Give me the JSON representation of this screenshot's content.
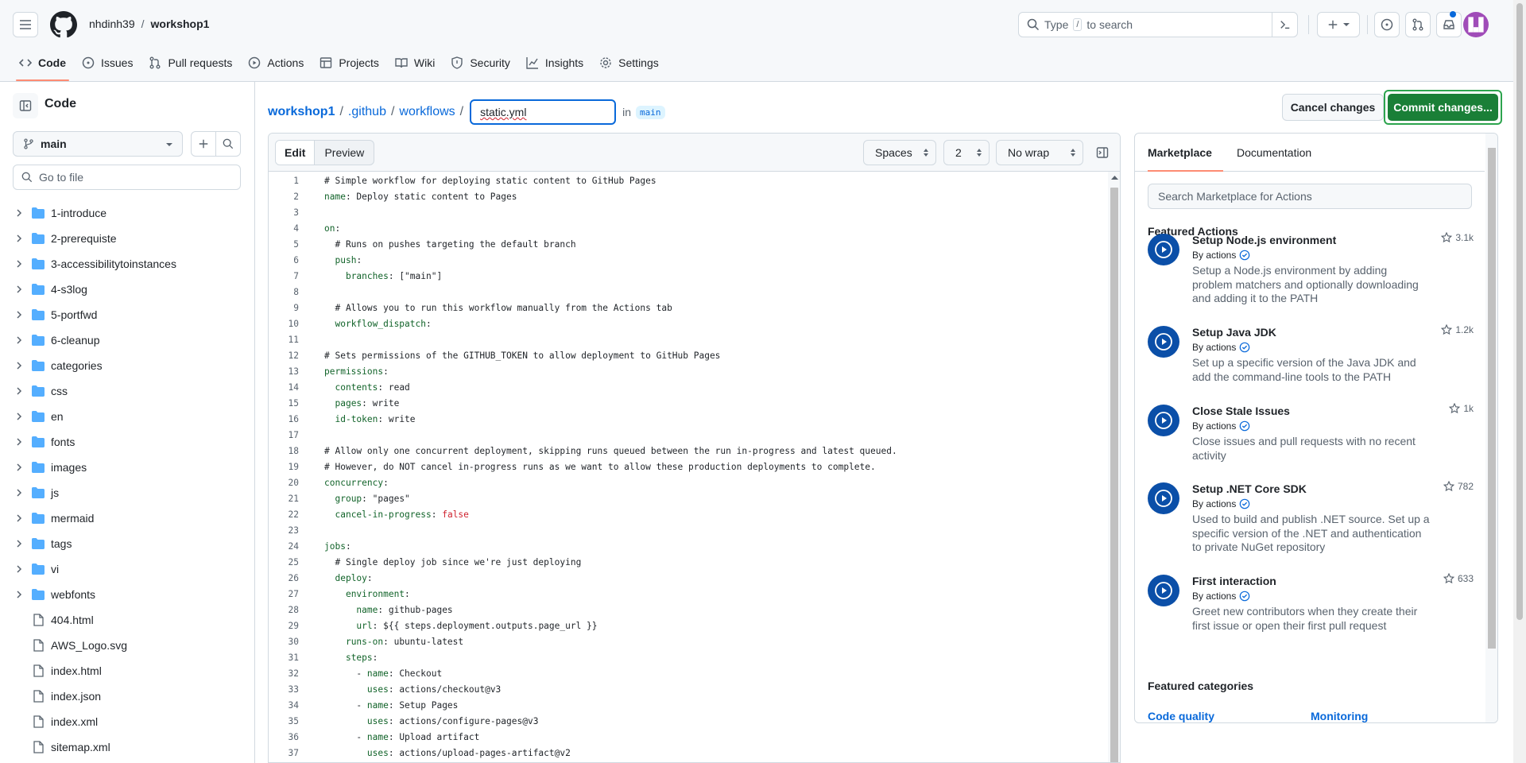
{
  "header": {
    "owner": "nhdinh39",
    "separator": "/",
    "repo": "workshop1",
    "search_placeholder_pre": "Type",
    "search_key": "/",
    "search_placeholder_post": "to search"
  },
  "tabs": [
    {
      "label": "Code",
      "icon": "code-icon",
      "selected": true
    },
    {
      "label": "Issues",
      "icon": "issue-opened-icon"
    },
    {
      "label": "Pull requests",
      "icon": "git-pull-request-icon"
    },
    {
      "label": "Actions",
      "icon": "play-icon"
    },
    {
      "label": "Projects",
      "icon": "table-icon"
    },
    {
      "label": "Wiki",
      "icon": "book-icon"
    },
    {
      "label": "Security",
      "icon": "shield-icon"
    },
    {
      "label": "Insights",
      "icon": "graph-icon"
    },
    {
      "label": "Settings",
      "icon": "gear-icon"
    }
  ],
  "sidebar": {
    "title": "Code",
    "branch": "main",
    "goto_placeholder": "Go to file",
    "items": [
      {
        "name": "1-introduce",
        "type": "dir"
      },
      {
        "name": "2-prerequiste",
        "type": "dir"
      },
      {
        "name": "3-accessibilitytoinstances",
        "type": "dir"
      },
      {
        "name": "4-s3log",
        "type": "dir"
      },
      {
        "name": "5-portfwd",
        "type": "dir"
      },
      {
        "name": "6-cleanup",
        "type": "dir"
      },
      {
        "name": "categories",
        "type": "dir"
      },
      {
        "name": "css",
        "type": "dir"
      },
      {
        "name": "en",
        "type": "dir"
      },
      {
        "name": "fonts",
        "type": "dir"
      },
      {
        "name": "images",
        "type": "dir"
      },
      {
        "name": "js",
        "type": "dir"
      },
      {
        "name": "mermaid",
        "type": "dir"
      },
      {
        "name": "tags",
        "type": "dir"
      },
      {
        "name": "vi",
        "type": "dir"
      },
      {
        "name": "webfonts",
        "type": "dir"
      },
      {
        "name": "404.html",
        "type": "file"
      },
      {
        "name": "AWS_Logo.svg",
        "type": "file"
      },
      {
        "name": "index.html",
        "type": "file"
      },
      {
        "name": "index.json",
        "type": "file"
      },
      {
        "name": "index.xml",
        "type": "file"
      },
      {
        "name": "sitemap.xml",
        "type": "file"
      }
    ]
  },
  "breadcrumb": {
    "repo": "workshop1",
    "dir1": ".github",
    "dir2": "workflows",
    "sep": "/",
    "filename": "static.yml",
    "in_label": "in",
    "branch": "main"
  },
  "actions": {
    "cancel": "Cancel changes",
    "commit": "Commit changes..."
  },
  "editor": {
    "edit_tab": "Edit",
    "preview_tab": "Preview",
    "indent_mode": "Spaces",
    "indent_size": "2",
    "wrap_mode": "No wrap",
    "lines": [
      "# Simple workflow for deploying static content to GitHub Pages",
      "name: Deploy static content to Pages",
      "",
      "on:",
      "  # Runs on pushes targeting the default branch",
      "  push:",
      "    branches: [\"main\"]",
      "",
      "  # Allows you to run this workflow manually from the Actions tab",
      "  workflow_dispatch:",
      "",
      "# Sets permissions of the GITHUB_TOKEN to allow deployment to GitHub Pages",
      "permissions:",
      "  contents: read",
      "  pages: write",
      "  id-token: write",
      "",
      "# Allow only one concurrent deployment, skipping runs queued between the run in-progress and latest queued.",
      "# However, do NOT cancel in-progress runs as we want to allow these production deployments to complete.",
      "concurrency:",
      "  group: \"pages\"",
      "  cancel-in-progress: false",
      "",
      "jobs:",
      "  # Single deploy job since we're just deploying",
      "  deploy:",
      "    environment:",
      "      name: github-pages",
      "      url: ${{ steps.deployment.outputs.page_url }}",
      "    runs-on: ubuntu-latest",
      "    steps:",
      "      - name: Checkout",
      "        uses: actions/checkout@v3",
      "      - name: Setup Pages",
      "        uses: actions/configure-pages@v3",
      "      - name: Upload artifact",
      "        uses: actions/upload-pages-artifact@v2"
    ]
  },
  "marketplace": {
    "tab_marketplace": "Marketplace",
    "tab_docs": "Documentation",
    "search_placeholder": "Search Marketplace for Actions",
    "featured_actions_title": "Featured Actions",
    "items": [
      {
        "title": "Setup Node.js environment",
        "by": "By actions",
        "stars": "3.1k",
        "desc": [
          "Setup a Node.js environment by adding",
          "problem matchers and optionally downloading",
          "and adding it to the PATH"
        ]
      },
      {
        "title": "Setup Java JDK",
        "by": "By actions",
        "stars": "1.2k",
        "desc": [
          "Set up a specific version of the Java JDK and",
          "add the command-line tools to the PATH"
        ]
      },
      {
        "title": "Close Stale Issues",
        "by": "By actions",
        "stars": "1k",
        "desc": [
          "Close issues and pull requests with no recent",
          "activity"
        ]
      },
      {
        "title": "Setup .NET Core SDK",
        "by": "By actions",
        "stars": "782",
        "desc": [
          "Used to build and publish .NET source. Set up a",
          "specific version of the .NET and authentication",
          "to private NuGet repository"
        ]
      },
      {
        "title": "First interaction",
        "by": "By actions",
        "stars": "633",
        "desc": [
          "Greet new contributors when they create their",
          "first issue or open their first pull request"
        ]
      }
    ],
    "featured_categories_title": "Featured categories",
    "categories": [
      "Code quality",
      "Monitoring"
    ]
  },
  "colors": {
    "accent": "#0969da",
    "commit_green": "#1a7f37",
    "tab_underline": "#fd8c73"
  }
}
